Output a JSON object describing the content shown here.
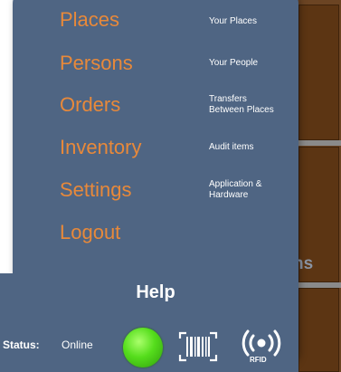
{
  "menu": {
    "items": [
      {
        "label": "Places",
        "description": "Your Places"
      },
      {
        "label": "Persons",
        "description": "Your People"
      },
      {
        "label": "Orders",
        "description_line1": "Transfers",
        "description_line2": "Between Places"
      },
      {
        "label": "Inventory",
        "description": "Audit items"
      },
      {
        "label": "Settings",
        "description_line1": "Application &",
        "description_line2": "Hardware"
      },
      {
        "label": "Logout"
      }
    ],
    "help_label": "Help"
  },
  "status": {
    "label": "Status:",
    "value": "Online",
    "light_color": "#55dd1c"
  },
  "tools": {
    "barcode_icon": "barcode-scanner-icon",
    "rfid_icon": "rfid-icon",
    "rfid_text": "RFID"
  },
  "background": {
    "partial_text": "ns"
  },
  "colors": {
    "drawer": "#4f6583",
    "menu_label": "#e8893a",
    "background_panel": "#6b4423"
  }
}
